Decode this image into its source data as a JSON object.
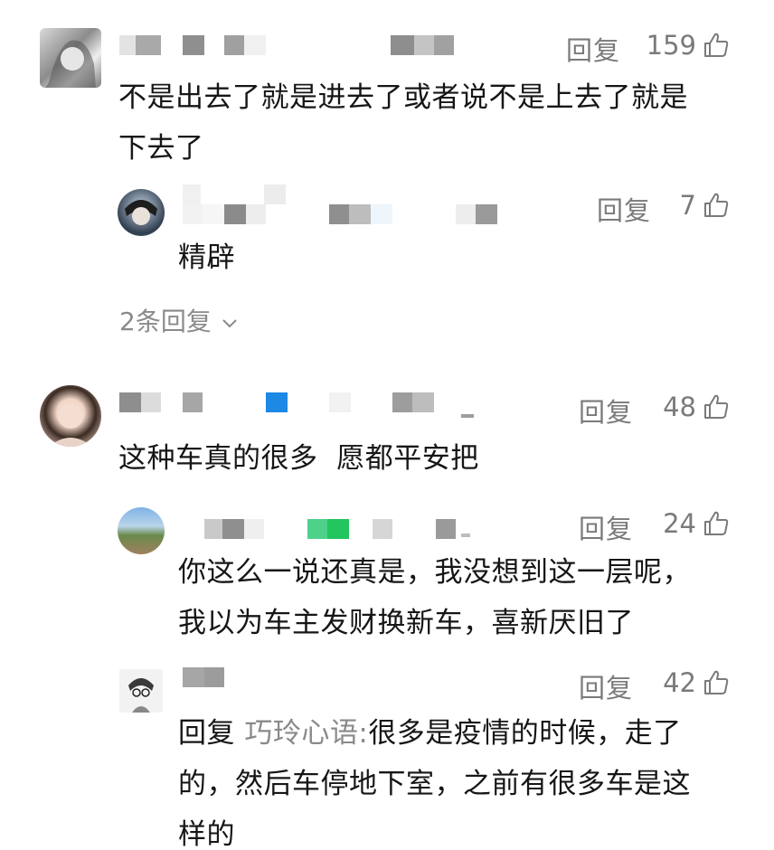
{
  "comments": [
    {
      "reply_label": "回复",
      "likes": "159",
      "text_line1": "不是出去了就是进去了或者说不是上去了就是",
      "text_line2": "下去了",
      "replies": [
        {
          "reply_label": "回复",
          "likes": "7",
          "text": "精辟"
        }
      ],
      "more_replies": "2条回复"
    },
    {
      "reply_label": "回复",
      "likes": "48",
      "text": "这种车真的很多  愿都平安把",
      "replies": [
        {
          "reply_label": "回复",
          "likes": "24",
          "text_line1": "你这么一说还真是，我没想到这一层呢，",
          "text_line2": "我以为车主发财换新车，喜新厌旧了"
        },
        {
          "reply_label": "回复",
          "likes": "42",
          "prefix": "回复",
          "quoted_user": "巧玲心语:",
          "text_line1_rest": "很多是疫情的时候，走了",
          "text_line2": "的，然后车停地下室，之前有很多车是这",
          "text_line3": "样的"
        }
      ]
    }
  ],
  "colors": {
    "text": "#161616",
    "secondary": "#7a7a7a",
    "quoted": "#8a8a8a",
    "blue_block": "#1e88e5",
    "green_block": "#22c55e"
  },
  "icons": [
    "thumbs-up-icon",
    "chevron-down-icon"
  ]
}
